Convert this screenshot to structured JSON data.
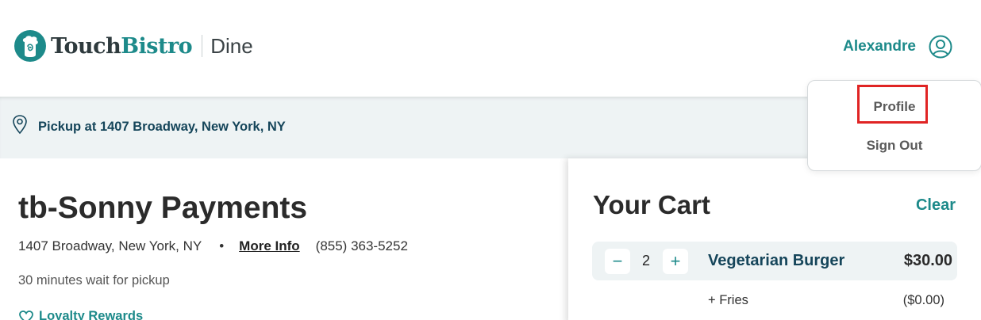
{
  "header": {
    "brand_part1": "Touch",
    "brand_part2": "Bistro",
    "product": "Dine",
    "user_name": "Alexandre",
    "brand_color": "#1d8a8a"
  },
  "user_menu": {
    "items": [
      "Profile",
      "Sign Out"
    ],
    "highlighted_item": "Profile"
  },
  "pickup": {
    "text": "Pickup at 1407 Broadway, New York, NY",
    "icon": "location-pin-icon"
  },
  "restaurant": {
    "name": "tb-Sonny Payments",
    "address": "1407 Broadway, New York, NY",
    "separator": "•",
    "more_info_label": "More Info",
    "phone": "(855) 363-5252",
    "wait_text": "30 minutes wait for pickup",
    "loyalty_label": "Loyalty Rewards"
  },
  "cart": {
    "title": "Your Cart",
    "clear_label": "Clear",
    "items": [
      {
        "quantity": "2",
        "name": "Vegetarian Burger",
        "price": "$30.00",
        "minus": "−",
        "plus": "+",
        "modifiers": [
          {
            "name": "+ Fries",
            "price": "($0.00)"
          }
        ]
      }
    ]
  }
}
